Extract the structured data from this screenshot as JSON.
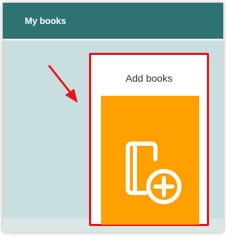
{
  "header": {
    "title": "My books"
  },
  "add_books_card": {
    "label": "Add books",
    "tile_color": "#ffa000",
    "icon": "book-add-icon",
    "highlight_color": "#e8141c"
  },
  "annotation": {
    "icon": "red-arrow-icon"
  },
  "theme": {
    "header_bg": "#2f7272",
    "content_bg": "#c9dede"
  }
}
